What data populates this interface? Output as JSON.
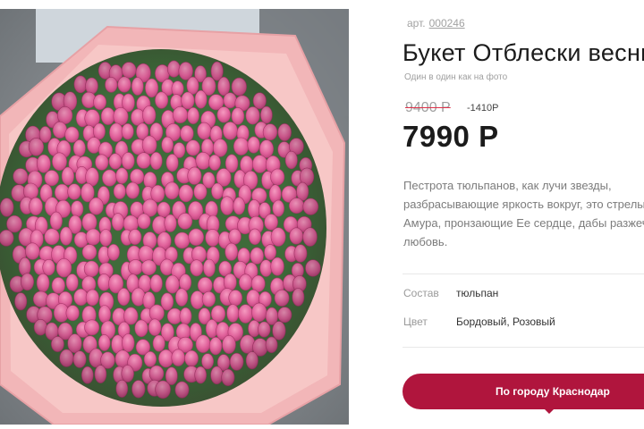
{
  "product": {
    "article_label": "арт.",
    "article_number": "000246",
    "title": "Букет Отблески весны",
    "subtitle": "Один в один как на фото",
    "old_price": "9400 Р",
    "discount": "-1410Р",
    "price": "7990 Р",
    "description": "Пестрота тюльпанов, как лучи звезды, разбрасывающие яркость вокруг, это стрелы Амура, пронзающие Ее сердце, дабы разжечь любовь.",
    "properties": [
      {
        "label": "Состав",
        "value": "тюльпан"
      },
      {
        "label": "Цвет",
        "value": "Бордовый, Розовый"
      }
    ],
    "delivery_button_label": "По городу Краснодар"
  },
  "colors": {
    "accent": "#b0153d",
    "tulip_pink": "#e8679a",
    "wrapping_paper": "#f2b6b8",
    "price_strike": "#e0314a"
  },
  "photo": {
    "subject": "bouquet-of-pink-tulips"
  }
}
